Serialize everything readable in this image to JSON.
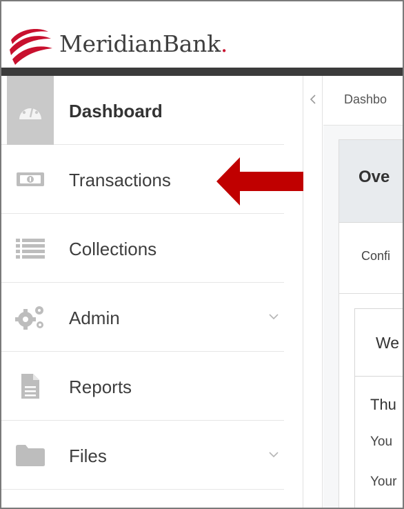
{
  "brand": {
    "name": "MeridianBank",
    "dot": ".",
    "accent_color": "#c8102e"
  },
  "sidebar": {
    "items": [
      {
        "label": "Dashboard",
        "icon": "dashboard-gauge-icon",
        "active": true
      },
      {
        "label": "Transactions",
        "icon": "money-bill-icon"
      },
      {
        "label": "Collections",
        "icon": "list-icon"
      },
      {
        "label": "Admin",
        "icon": "gears-icon",
        "expandable": true
      },
      {
        "label": "Reports",
        "icon": "document-icon"
      },
      {
        "label": "Files",
        "icon": "folder-icon",
        "expandable": true
      }
    ],
    "active_bg": "#c9c9c9"
  },
  "annotation": {
    "icon": "red-arrow-icon",
    "color": "#c00000"
  },
  "main": {
    "breadcrumb": "Dashbo",
    "panel_title": "Ove",
    "panel_subtitle": "Confi",
    "card": {
      "title": "We",
      "line1": "Thu",
      "line2": "You",
      "line3": "Your"
    }
  }
}
